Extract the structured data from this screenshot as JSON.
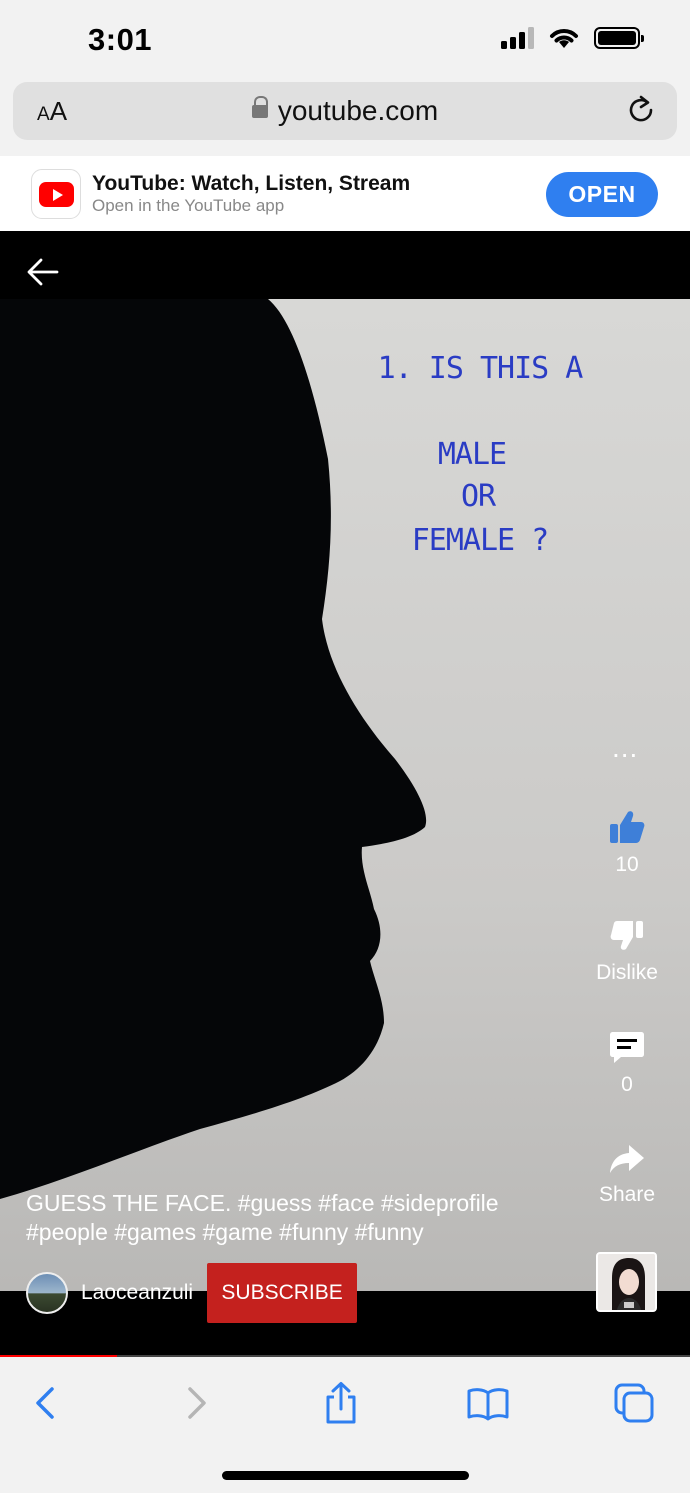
{
  "status_bar": {
    "time": "3:01"
  },
  "browser": {
    "text_size_small": "A",
    "text_size_large": "A",
    "url": "youtube.com"
  },
  "app_banner": {
    "title": "YouTube: Watch, Listen, Stream",
    "subtitle": "Open in the YouTube app",
    "open_label": "OPEN"
  },
  "video": {
    "overlay_text": {
      "line1": "1. IS THIS A",
      "line2": "MALE",
      "line3": "OR",
      "line4": "FEMALE ?"
    },
    "actions": {
      "more": "...",
      "like_count": "10",
      "dislike_label": "Dislike",
      "comment_count": "0",
      "share_label": "Share"
    },
    "caption_line1": "GUESS THE FACE. #guess #face #sideprofile",
    "caption_line2": "#people #games #game #funny #funny",
    "channel": {
      "name": "Laoceanzuli",
      "subscribe_label": "SUBSCRIBE"
    },
    "progress": 0.17
  },
  "colors": {
    "accent_blue": "#2f7ff0",
    "youtube_red": "#ff0000",
    "subscribe_red": "#c4211e",
    "safari_blue": "#2f7ff0"
  },
  "icons": {
    "back": "arrow-left-icon",
    "like": "thumbs-up-icon",
    "dislike": "thumbs-down-icon",
    "comment": "comment-icon",
    "share": "share-arrow-icon",
    "reload": "reload-icon",
    "lock": "lock-icon"
  }
}
